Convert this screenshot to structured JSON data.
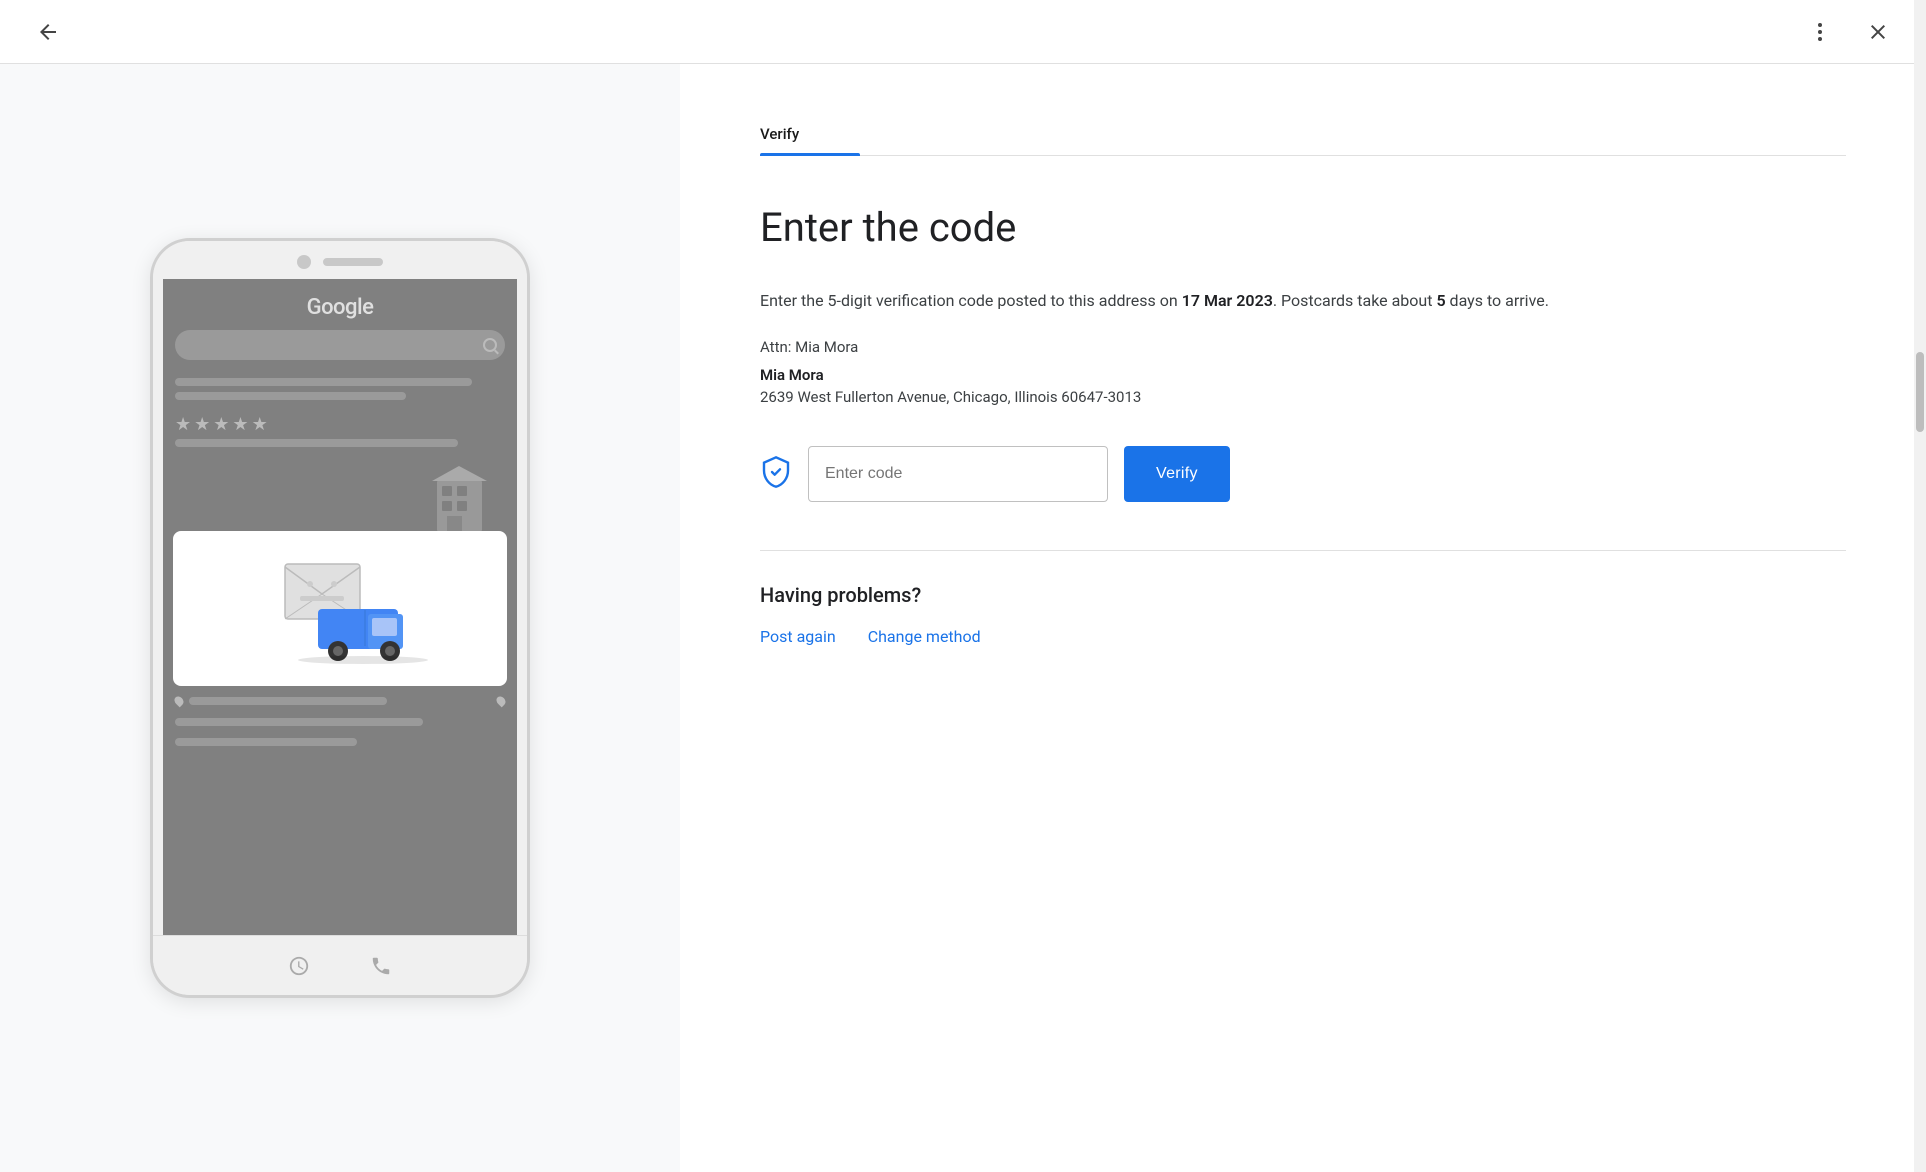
{
  "header": {
    "back_label": "Back",
    "more_label": "More options",
    "close_label": "Close"
  },
  "phone": {
    "google_text": "Google",
    "stars": [
      "★",
      "★",
      "★",
      "★",
      "★"
    ]
  },
  "right_panel": {
    "tab_label": "Verify",
    "heading": "Enter the code",
    "description_part1": "Enter the 5-digit verification code posted to this address on ",
    "date_bold": "17 Mar 2023",
    "description_part2": ". Postcards take about ",
    "days_bold": "5",
    "description_part3": " days to arrive.",
    "attn_label": "Attn: Mia Mora",
    "address_name": "Mia Mora",
    "address": "2639 West Fullerton Avenue, Chicago, Illinois 60647-3013",
    "code_placeholder": "Enter code",
    "verify_button": "Verify",
    "problems_heading": "Having problems?",
    "post_again_link": "Post again",
    "change_method_link": "Change method"
  }
}
